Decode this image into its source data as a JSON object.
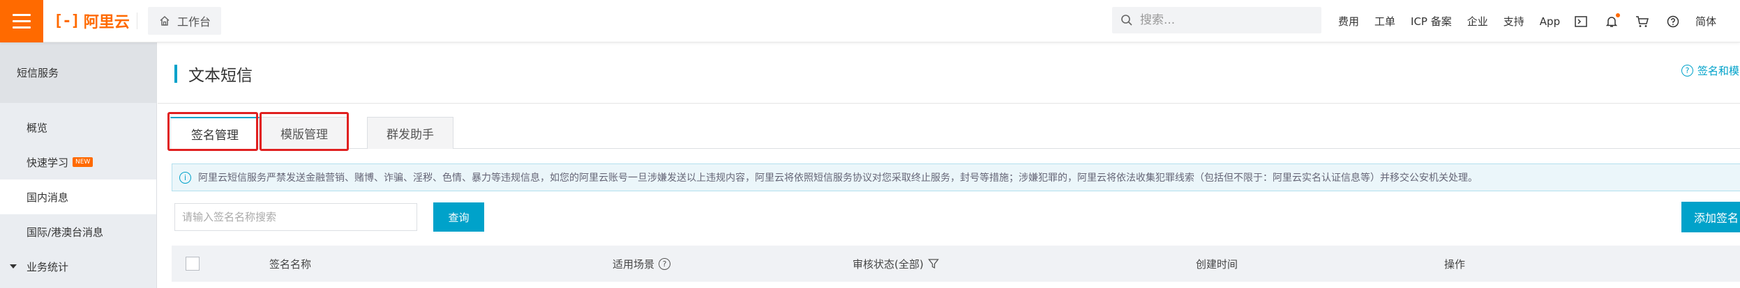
{
  "topbar": {
    "logo_mark": "[-]",
    "logo_text": "阿里云",
    "workbench_label": "工作台",
    "search_placeholder": "搜索...",
    "links": {
      "fees": "费用",
      "tickets": "工单",
      "icp": "ICP 备案",
      "enterprise": "企业",
      "support": "支持",
      "app": "App",
      "language": "简体"
    },
    "icons": [
      "cloud-shell-icon",
      "bell-icon",
      "cart-icon",
      "help-icon"
    ],
    "accent_color": "#ff6a00"
  },
  "sidebar": {
    "title": "短信服务",
    "items": [
      {
        "label": "概览"
      },
      {
        "label": "快速学习",
        "badge": "NEW"
      },
      {
        "label": "国内消息",
        "active": true
      },
      {
        "label": "国际/港澳台消息"
      },
      {
        "label": "业务统计",
        "expandable": true
      }
    ]
  },
  "main": {
    "title": "文本短信",
    "help_link": "签名和模",
    "tabs": [
      {
        "label": "签名管理",
        "active": true
      },
      {
        "label": "模版管理"
      },
      {
        "label": "群发助手"
      }
    ],
    "alert": "阿里云短信服务严禁发送金融营销、赌博、诈骗、淫秽、色情、暴力等违规信息，如您的阿里云账号一旦涉嫌发送以上违规内容，阿里云将依照短信服务协议对您采取终止服务，封号等措施；涉嫌犯罪的，阿里云将依法收集犯罪线索（包括但不限于：阿里云实名认证信息等）并移交公安机关处理。",
    "filter_placeholder": "请输入签名名称搜索",
    "query_label": "查询",
    "add_label": "添加签名",
    "table": {
      "columns": [
        "签名名称",
        "适用场景",
        "审核状态(全部)",
        "创建时间",
        "操作"
      ]
    },
    "accent_color": "#00a2ca",
    "highlight_color": "#e02020"
  }
}
